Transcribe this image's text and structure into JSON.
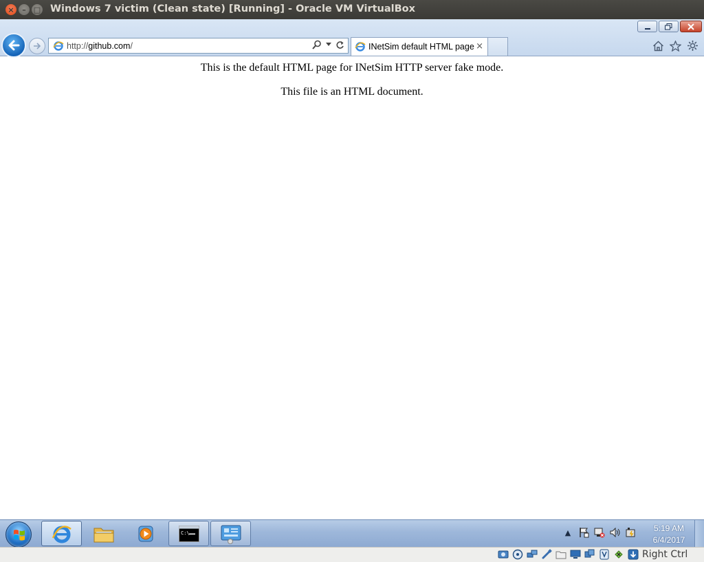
{
  "host_window": {
    "title": "Windows 7 victim (Clean state) [Running] - Oracle VM VirtualBox",
    "close_glyph": "×",
    "min_glyph": "–",
    "max_glyph": "□"
  },
  "browser": {
    "url_prefix": "http://",
    "url_domain": "github.com",
    "url_suffix": "/",
    "tab_title": "INetSim default HTML page",
    "tab_close_glyph": "×",
    "icons": [
      "back-icon",
      "forward-icon",
      "search-icon",
      "refresh-icon",
      "home-icon",
      "favorites-star-icon",
      "tools-gear-icon"
    ]
  },
  "page": {
    "paragraph_1": "This is the default HTML page for INetSim HTTP server fake mode.",
    "paragraph_2": "This file is an HTML document."
  },
  "taskbar": {
    "clock_time": "5:19 AM",
    "clock_date": "6/4/2017",
    "tray_overflow_glyph": "▲",
    "pinned": [
      "internet-explorer",
      "windows-explorer",
      "media-player",
      "command-prompt",
      "control-panel"
    ]
  },
  "vbox_status": {
    "host_key": "Right Ctrl"
  },
  "colors": {
    "host_titlebar": "#3b3a36",
    "ie_chrome": "#c6d8ee",
    "taskbar": "#9db7da",
    "back_button": "#1564b8"
  }
}
